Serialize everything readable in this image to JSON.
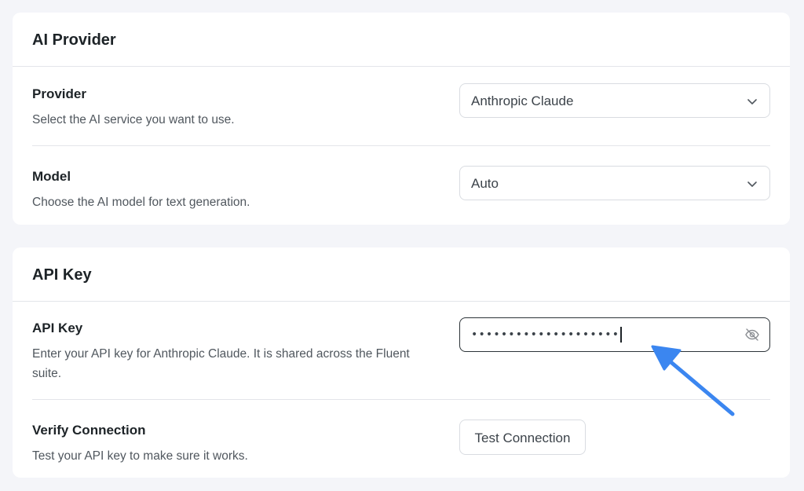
{
  "provider_section": {
    "title": "AI Provider",
    "provider": {
      "label": "Provider",
      "description": "Select the AI service you want to use.",
      "selected": "Anthropic Claude"
    },
    "model": {
      "label": "Model",
      "description": "Choose the AI model for text generation.",
      "selected": "Auto"
    }
  },
  "apikey_section": {
    "title": "API Key",
    "api_key": {
      "label": "API Key",
      "description": "Enter your API key for Anthropic Claude. It is shared across the Fluent suite.",
      "masked_value": "••••••••••••••••••••"
    },
    "verify": {
      "label": "Verify Connection",
      "description": "Test your API key to make sure it works.",
      "button_label": "Test Connection"
    }
  },
  "icons": {
    "select_chevron": "chevron-down-icon",
    "visibility_toggle": "eye-off-icon",
    "annotation": "arrow-icon"
  },
  "colors": {
    "page_background": "#f4f5f9",
    "card_background": "#ffffff",
    "annotation_arrow": "#3b86f0",
    "focused_border": "#2c3338"
  }
}
